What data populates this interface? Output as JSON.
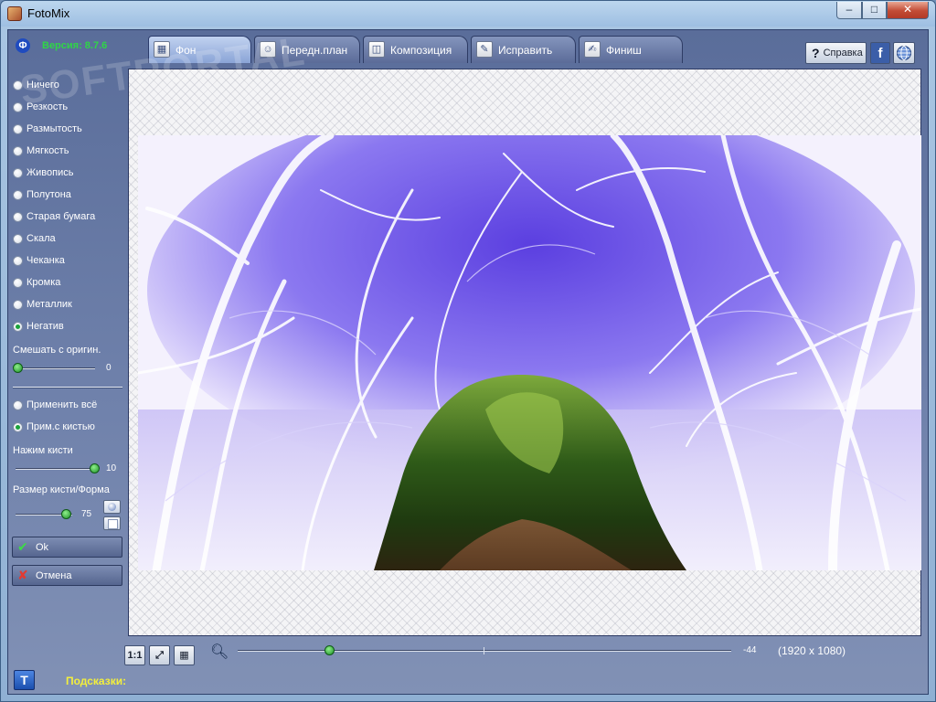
{
  "window": {
    "title": "FotoMix",
    "minimize_label": "–",
    "maximize_label": "□",
    "close_label": "✕"
  },
  "left_panel": {
    "version": "Версия: 8.7.6",
    "effects": [
      {
        "label": "Ничего",
        "selected": false
      },
      {
        "label": "Резкость",
        "selected": false
      },
      {
        "label": "Размытость",
        "selected": false
      },
      {
        "label": "Мягкость",
        "selected": false
      },
      {
        "label": "Живопись",
        "selected": false
      },
      {
        "label": "Полутона",
        "selected": false
      },
      {
        "label": "Старая бумага",
        "selected": false
      },
      {
        "label": "Скала",
        "selected": false
      },
      {
        "label": "Чеканка",
        "selected": false
      },
      {
        "label": "Кромка",
        "selected": false
      },
      {
        "label": "Металлик",
        "selected": false
      },
      {
        "label": "Негатив",
        "selected": true
      }
    ],
    "blend_label": "Смешать с оригин.",
    "blend_value": "0",
    "apply_modes": [
      {
        "label": "Применить всё",
        "selected": false
      },
      {
        "label": "Прим.с кистью",
        "selected": true
      }
    ],
    "brush_pressure_label": "Нажим кисти",
    "brush_pressure_value": "10",
    "brush_size_label": "Размер кисти/Форма",
    "brush_size_value": "75",
    "ok_label": "Ok",
    "cancel_label": "Отмена"
  },
  "tabs": [
    {
      "label": "Фон",
      "active": true
    },
    {
      "label": "Передн.план",
      "active": false
    },
    {
      "label": "Композиция",
      "active": false
    },
    {
      "label": "Исправить",
      "active": false
    },
    {
      "label": "Финиш",
      "active": false
    }
  ],
  "top_buttons": {
    "help_label": "Справка",
    "facebook_label": "f"
  },
  "bottom_bar": {
    "actual_size_label": "1:1",
    "zoom_value": "-44",
    "image_size": "(1920 x 1080)",
    "hints_label": "Подсказки:"
  },
  "watermark": "SOFTPORTAL",
  "colors": {
    "version_green": "#2fd646",
    "hints_yellow": "#f3ef3c",
    "slider_green": "#1b8f28"
  }
}
